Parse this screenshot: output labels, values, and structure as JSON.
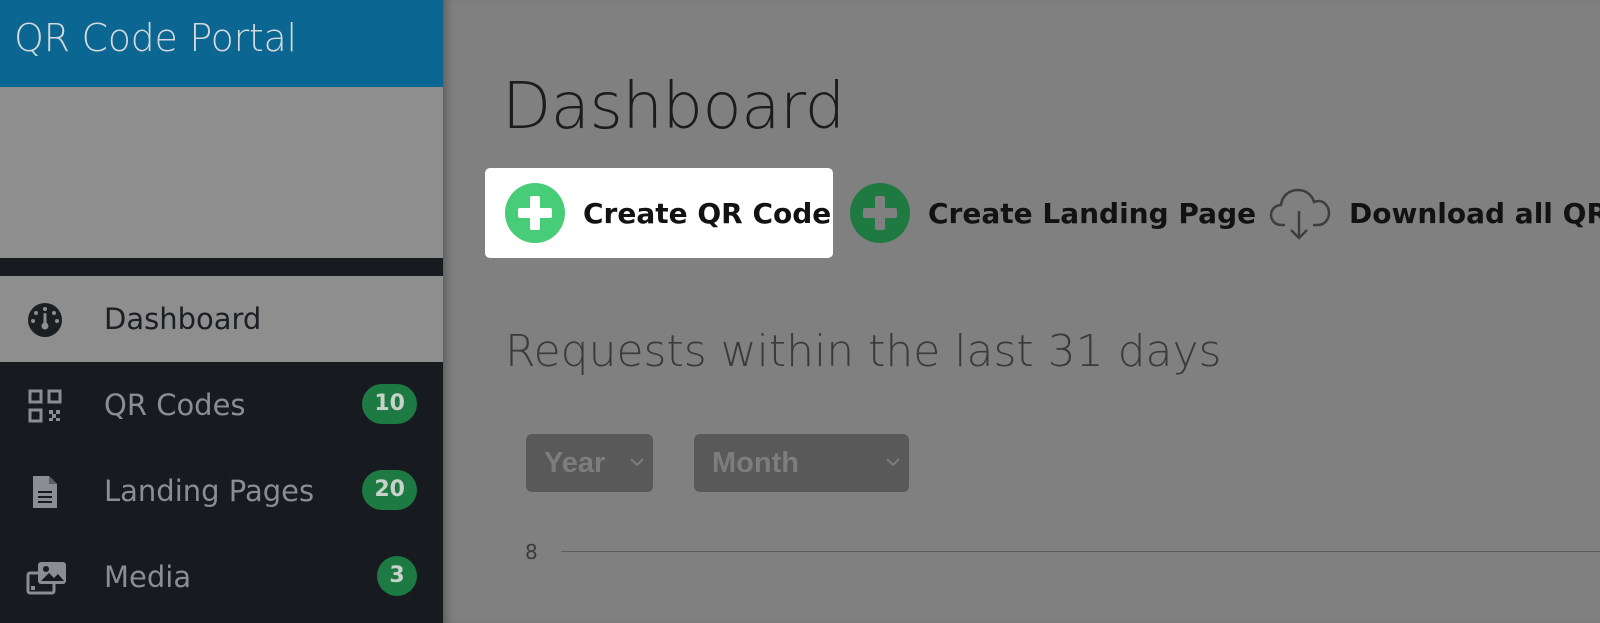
{
  "app": {
    "title": "QR Code Portal"
  },
  "sidebar": {
    "items": [
      {
        "label": "Dashboard",
        "icon": "dashboard-gauge-icon",
        "active": true
      },
      {
        "label": "QR Codes",
        "icon": "qrcode-icon",
        "badge": "10"
      },
      {
        "label": "Landing Pages",
        "icon": "file-icon",
        "badge": "20"
      },
      {
        "label": "Media",
        "icon": "images-icon",
        "badge": "3"
      }
    ]
  },
  "main": {
    "title": "Dashboard",
    "actions": [
      {
        "label": "Create QR Code",
        "icon": "plus-circle-icon",
        "color": "#47cc78",
        "highlighted": true
      },
      {
        "label": "Create Landing Page",
        "icon": "plus-circle-icon",
        "color": "#1f7a42"
      },
      {
        "label": "Download all QR",
        "icon": "cloud-download-icon"
      }
    ],
    "section_title": "Requests within the last 31 days",
    "filters": {
      "year": "Year",
      "month": "Month"
    },
    "chart_axis_tick": "8"
  },
  "colors": {
    "brand": "#0b6791",
    "sidebar_bg": "#171b20",
    "badge": "#1d7a43",
    "overlay": "#808080"
  }
}
